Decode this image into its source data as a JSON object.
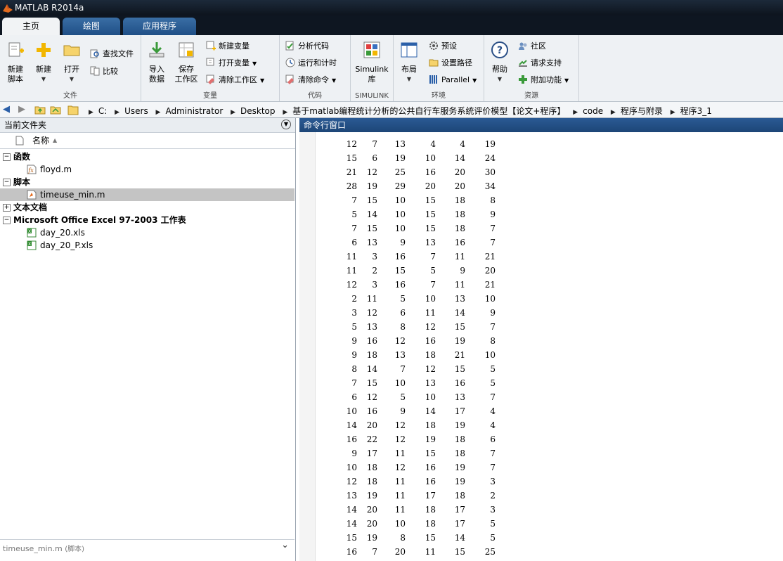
{
  "window": {
    "title": "MATLAB R2014a"
  },
  "tabs": [
    {
      "label": "主页",
      "active": true
    },
    {
      "label": "绘图",
      "active": false
    },
    {
      "label": "应用程序",
      "active": false
    }
  ],
  "ribbon": {
    "file": {
      "label": "文件",
      "new_script": "新建\n脚本",
      "new": "新建",
      "open": "打开",
      "find_files": "查找文件",
      "compare": "比较"
    },
    "variable": {
      "label": "变量",
      "import": "导入\n数据",
      "save_ws": "保存\n工作区",
      "new_var": "新建变量",
      "open_var": "打开变量",
      "clear_ws": "清除工作区"
    },
    "code": {
      "label": "代码",
      "analyze": "分析代码",
      "run_time": "运行和计时",
      "clear_cmd": "清除命令"
    },
    "simulink": {
      "label": "SIMULINK",
      "lib": "Simulink\n库"
    },
    "env": {
      "label": "环境",
      "layout": "布局",
      "prefs": "预设",
      "set_path": "设置路径",
      "parallel": "Parallel"
    },
    "resources": {
      "label": "资源",
      "help": "帮助",
      "community": "社区",
      "support": "请求支持",
      "addons": "附加功能"
    }
  },
  "breadcrumbs": [
    "C:",
    "Users",
    "Administrator",
    "Desktop",
    "基于matlab编程统计分析的公共自行车服务系统评价模型【论文+程序】",
    "code",
    "程序与附录",
    "程序3_1"
  ],
  "current_folder": {
    "title": "当前文件夹",
    "column_name": "名称",
    "categories": {
      "functions": "函数",
      "scripts": "脚本",
      "text_docs": "文本文档",
      "excel": "Microsoft Office Excel 97-2003 工作表"
    },
    "files": {
      "floyd": "floyd.m",
      "timeuse": "timeuse_min.m",
      "day20": "day_20.xls",
      "day20p": "day_20_P.xls"
    },
    "footer_file": "timeuse_min.m",
    "footer_type": "(脚本)"
  },
  "command_window": {
    "title": "命令行窗口",
    "rows": [
      [
        12,
        7,
        13,
        4,
        4,
        19
      ],
      [
        15,
        6,
        19,
        10,
        14,
        24
      ],
      [
        21,
        12,
        25,
        16,
        20,
        30
      ],
      [
        28,
        19,
        29,
        20,
        20,
        34
      ],
      [
        7,
        15,
        10,
        15,
        18,
        8
      ],
      [
        5,
        14,
        10,
        15,
        18,
        9
      ],
      [
        7,
        15,
        10,
        15,
        18,
        7
      ],
      [
        6,
        13,
        9,
        13,
        16,
        7
      ],
      [
        11,
        3,
        16,
        7,
        11,
        21
      ],
      [
        11,
        2,
        15,
        5,
        9,
        20
      ],
      [
        12,
        3,
        16,
        7,
        11,
        21
      ],
      [
        2,
        11,
        5,
        10,
        13,
        10
      ],
      [
        3,
        12,
        6,
        11,
        14,
        9
      ],
      [
        5,
        13,
        8,
        12,
        15,
        7
      ],
      [
        9,
        16,
        12,
        16,
        19,
        8
      ],
      [
        9,
        18,
        13,
        18,
        21,
        10
      ],
      [
        8,
        14,
        7,
        12,
        15,
        5
      ],
      [
        7,
        15,
        10,
        13,
        16,
        5
      ],
      [
        6,
        12,
        5,
        10,
        13,
        7
      ],
      [
        10,
        16,
        9,
        14,
        17,
        4
      ],
      [
        14,
        20,
        12,
        18,
        19,
        4
      ],
      [
        16,
        22,
        12,
        19,
        18,
        6
      ],
      [
        9,
        17,
        11,
        15,
        18,
        7
      ],
      [
        10,
        18,
        12,
        16,
        19,
        7
      ],
      [
        12,
        18,
        11,
        16,
        19,
        3
      ],
      [
        13,
        19,
        11,
        17,
        18,
        2
      ],
      [
        14,
        20,
        11,
        18,
        17,
        3
      ],
      [
        14,
        20,
        10,
        18,
        17,
        5
      ],
      [
        15,
        19,
        8,
        15,
        14,
        5
      ],
      [
        16,
        7,
        20,
        11,
        15,
        25
      ]
    ]
  }
}
